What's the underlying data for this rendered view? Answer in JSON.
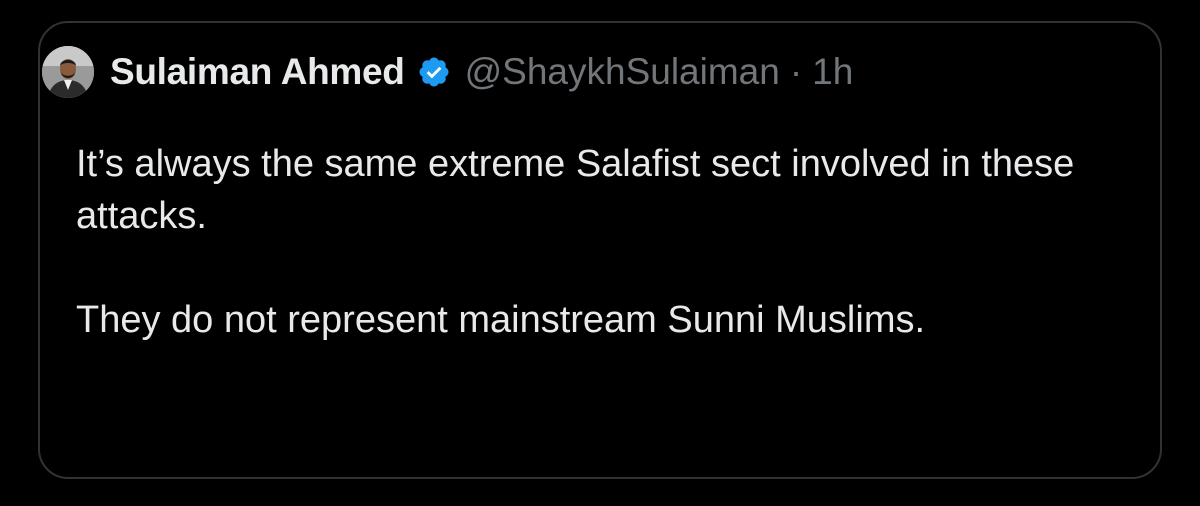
{
  "tweet": {
    "author_name": "Sulaiman Ahmed",
    "handle": "@ShaykhSulaiman",
    "separator": "·",
    "time": "1h",
    "verified_icon": "verified-badge-icon",
    "avatar_icon": "avatar",
    "paragraphs": [
      "It’s always the same extreme Salafist sect involved in these attacks.",
      "They do not represent mainstream Sunni Muslims."
    ]
  },
  "colors": {
    "background": "#000000",
    "border": "#2f3336",
    "text_primary": "#e7e9ea",
    "text_secondary": "#71767b",
    "verified_blue": "#1d9bf0"
  }
}
